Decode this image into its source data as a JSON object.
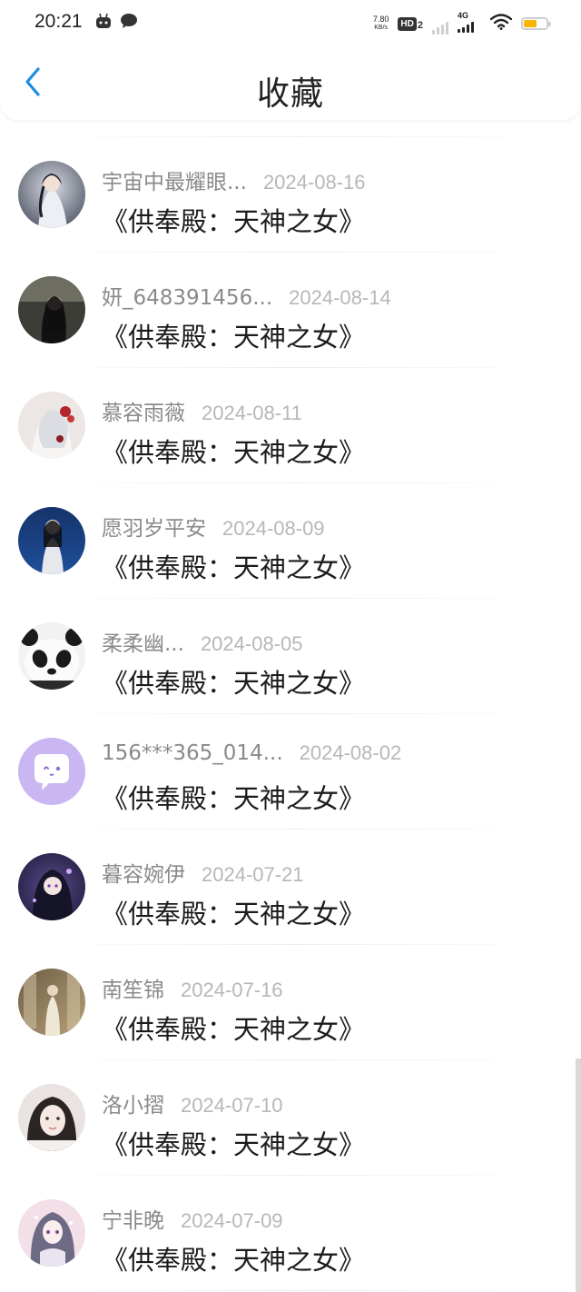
{
  "status_bar": {
    "time": "20:21",
    "net_speed_value": "7.80",
    "net_speed_unit": "KB/s",
    "hd_label": "HD",
    "hd_sub": "2",
    "network_type": "4G",
    "battery_percent": 60,
    "battery_color": "#f7b500",
    "left_icons": [
      "robot-icon",
      "chat-bubble-icon"
    ]
  },
  "header": {
    "title": "收藏",
    "back_icon": "chevron-left-icon",
    "accent_color": "#1a8fe3"
  },
  "favorites": [
    {
      "user": "宇宙中最耀眼...",
      "date": "2024-08-16",
      "book": "《供奉殿：天神之女》"
    },
    {
      "user": "妍_648391456...",
      "date": "2024-08-14",
      "book": "《供奉殿：天神之女》"
    },
    {
      "user": "慕容雨薇",
      "date": "2024-08-11",
      "book": "《供奉殿：天神之女》"
    },
    {
      "user": "愿羽岁平安",
      "date": "2024-08-09",
      "book": "《供奉殿：天神之女》"
    },
    {
      "user": "柔柔幽...",
      "date": "2024-08-05",
      "book": "《供奉殿：天神之女》"
    },
    {
      "user": "156***365_014...",
      "date": "2024-08-02",
      "book": "《供奉殿：天神之女》"
    },
    {
      "user": "暮容婉伊",
      "date": "2024-07-21",
      "book": "《供奉殿：天神之女》"
    },
    {
      "user": "南笙锦",
      "date": "2024-07-16",
      "book": "《供奉殿：天神之女》"
    },
    {
      "user": "洛小摺",
      "date": "2024-07-10",
      "book": "《供奉殿：天神之女》"
    },
    {
      "user": "宁非晚",
      "date": "2024-07-09",
      "book": "《供奉殿：天神之女》"
    }
  ]
}
